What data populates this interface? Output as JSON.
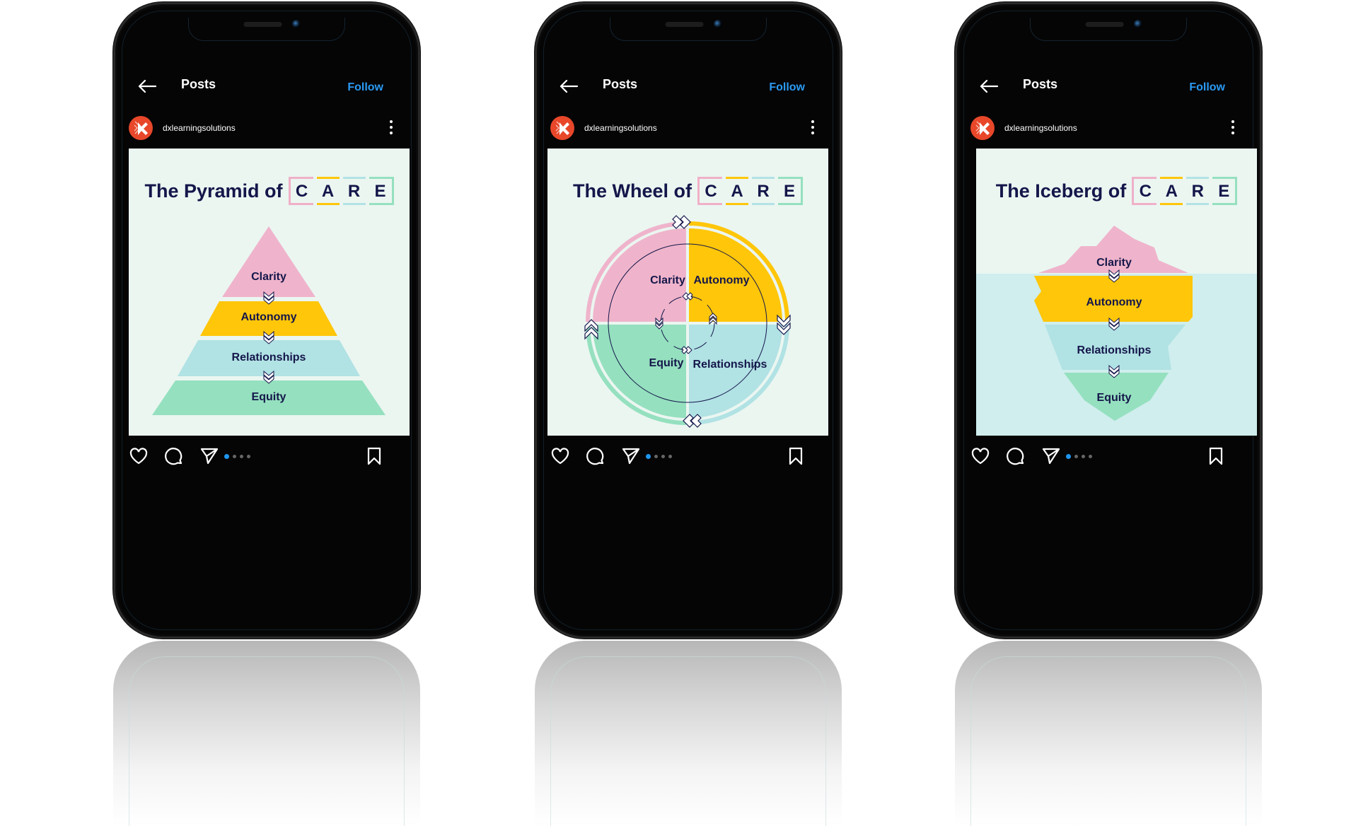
{
  "colors": {
    "follow": "#2b9af3",
    "active_dot": "#1e96f0",
    "clarity": "#efb4cb",
    "autonomy": "#ffc60a",
    "relationships": "#b1e2e4",
    "equity": "#95e0bf",
    "title_text": "#14164a",
    "post_bg": "#ebf6f1",
    "water": "#cfeeed",
    "avatar": "#e8472a"
  },
  "phones": [
    {
      "header": {
        "title": "Posts",
        "follow_label": "Follow"
      },
      "account": {
        "username": "dxlearningsolutions"
      },
      "post": {
        "title_prefix": "The Pyramid of",
        "acronym": [
          "C",
          "A",
          "R",
          "E"
        ],
        "diagram": "pyramid",
        "layers": [
          "Clarity",
          "Autonomy",
          "Relationships",
          "Equity"
        ]
      },
      "carousel": {
        "count": 4,
        "active": 1
      },
      "icons": [
        "back-arrow-icon",
        "more-vertical-icon",
        "heart-icon",
        "comment-icon",
        "share-icon",
        "bookmark-icon"
      ]
    },
    {
      "header": {
        "title": "Posts",
        "follow_label": "Follow"
      },
      "account": {
        "username": "dxlearningsolutions"
      },
      "post": {
        "title_prefix": "The Wheel of",
        "acronym": [
          "C",
          "A",
          "R",
          "E"
        ],
        "diagram": "wheel",
        "layers": [
          "Clarity",
          "Autonomy",
          "Relationships",
          "Equity"
        ]
      },
      "carousel": {
        "count": 4,
        "active": 1
      },
      "icons": [
        "back-arrow-icon",
        "more-vertical-icon",
        "heart-icon",
        "comment-icon",
        "share-icon",
        "bookmark-icon"
      ]
    },
    {
      "header": {
        "title": "Posts",
        "follow_label": "Follow"
      },
      "account": {
        "username": "dxlearningsolutions"
      },
      "post": {
        "title_prefix": "The Iceberg of",
        "acronym": [
          "C",
          "A",
          "R",
          "E"
        ],
        "diagram": "iceberg",
        "layers": [
          "Clarity",
          "Autonomy",
          "Relationships",
          "Equity"
        ]
      },
      "carousel": {
        "count": 4,
        "active": 1
      },
      "icons": [
        "back-arrow-icon",
        "more-vertical-icon",
        "heart-icon",
        "comment-icon",
        "share-icon",
        "bookmark-icon"
      ]
    }
  ]
}
